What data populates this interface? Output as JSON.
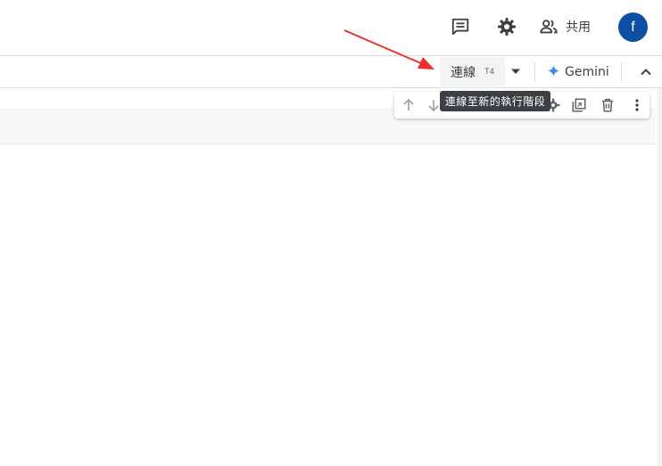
{
  "header": {
    "share_label": "共用",
    "avatar_initial": "f"
  },
  "toolbar": {
    "connect_label": "連線",
    "connect_sub": "T4",
    "gemini_label": "Gemini"
  },
  "tooltip": {
    "text": "連線至新的執行階段"
  },
  "colors": {
    "avatar_bg": "#0d4fa3",
    "tooltip_bg": "#3c4043",
    "annotation_arrow": "#e8322a",
    "gemini_star": "#4285f4"
  }
}
